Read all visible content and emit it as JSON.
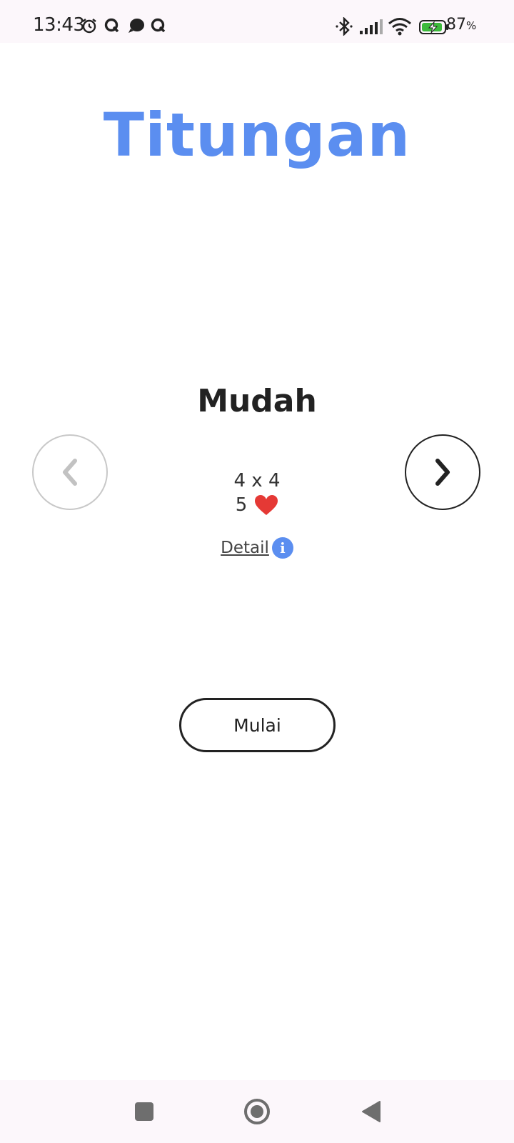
{
  "status_bar": {
    "time": "13:43",
    "battery_percent": "87",
    "battery_unit": "%",
    "icons": [
      "alarm-icon",
      "q-app-icon",
      "chat-bubble-icon",
      "q-app-icon",
      "bluetooth-icon",
      "signal-icon",
      "wifi-icon",
      "battery-charging-icon"
    ]
  },
  "app": {
    "title": "Titungan",
    "title_color": "#5b8ef0"
  },
  "level": {
    "name": "Mudah",
    "grid": "4 x 4",
    "lives": "5",
    "lives_icon": "heart-icon",
    "heart_color": "#e53935",
    "detail_label": "Detail",
    "detail_icon": "info-icon",
    "info_color": "#5b8ef0",
    "prev_icon": "chevron-left-icon",
    "next_icon": "chevron-right-icon",
    "prev_enabled": false,
    "next_enabled": true
  },
  "actions": {
    "start_label": "Mulai"
  },
  "nav_bar": {
    "buttons": [
      "recents-square-icon",
      "home-circle-icon",
      "back-triangle-icon"
    ]
  }
}
